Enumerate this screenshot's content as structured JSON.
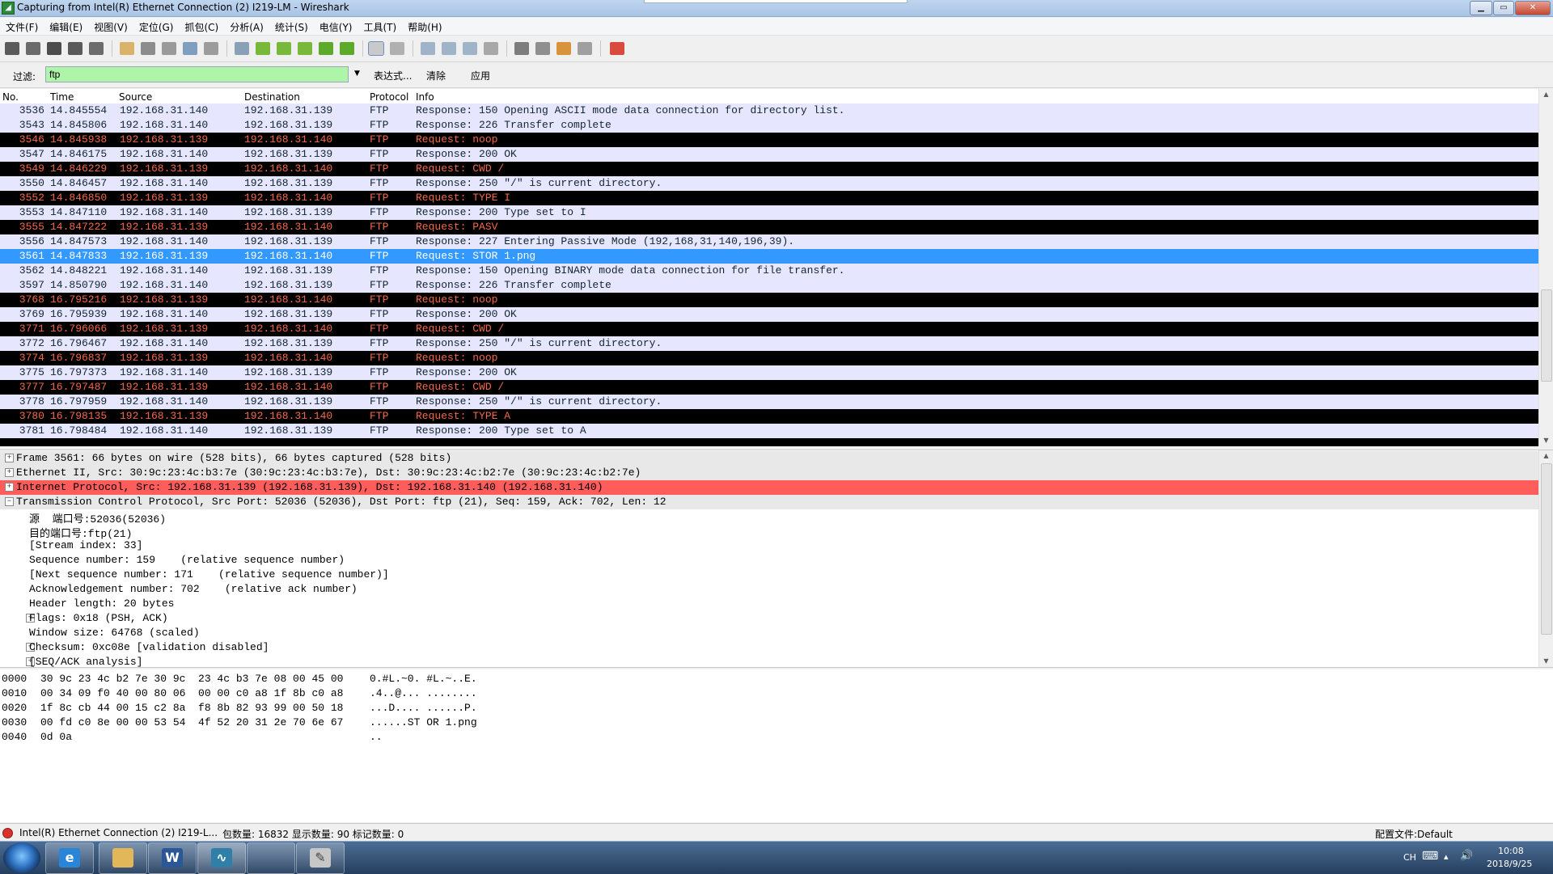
{
  "window": {
    "title": "Capturing from Intel(R) Ethernet Connection (2) I219-LM - Wireshark",
    "app_icon": "wireshark-icon",
    "controls": [
      "minimize-icon",
      "maximize-icon",
      "close-icon"
    ]
  },
  "menu": [
    "文件(F)",
    "编辑(E)",
    "视图(V)",
    "定位(G)",
    "抓包(C)",
    "分析(A)",
    "统计(S)",
    "电信(Y)",
    "工具(T)",
    "帮助(H)"
  ],
  "toolbar": {
    "icons": [
      "interfaces-icon",
      "options-icon",
      "start-capture-icon",
      "stop-capture-icon",
      "restart-capture-icon",
      "open-file-icon",
      "save-file-icon",
      "close-file-icon",
      "reload-icon",
      "print-icon",
      "find-packet-icon",
      "go-back-icon",
      "go-forward-icon",
      "go-to-packet-icon",
      "go-first-icon",
      "go-last-icon",
      "colorize-icon",
      "autoscroll-icon",
      "zoom-in-icon",
      "zoom-out-icon",
      "normal-size-icon",
      "resize-columns-icon",
      "capture-filters-icon",
      "display-filters-icon",
      "coloring-rules-icon",
      "preferences-icon",
      "help-icon"
    ]
  },
  "filter": {
    "label": "过滤:",
    "value": "ftp",
    "expression_label": "表达式...",
    "clear_label": "清除",
    "apply_label": "应用",
    "valid_color": "#aff5a9"
  },
  "packet_list": {
    "columns": [
      "No.",
      "Time",
      "Source",
      "Destination",
      "Protocol",
      "Info"
    ],
    "rows": [
      {
        "no": "3536",
        "time": "14.845554",
        "src": "192.168.31.140",
        "dst": "192.168.31.139",
        "proto": "FTP",
        "info": "Response: 150 Opening ASCII mode data connection for directory list.",
        "style": "resp"
      },
      {
        "no": "3543",
        "time": "14.845806",
        "src": "192.168.31.140",
        "dst": "192.168.31.139",
        "proto": "FTP",
        "info": "Response: 226 Transfer complete",
        "style": "resp"
      },
      {
        "no": "3546",
        "time": "14.845938",
        "src": "192.168.31.139",
        "dst": "192.168.31.140",
        "proto": "FTP",
        "info": "Request: noop",
        "style": "req"
      },
      {
        "no": "3547",
        "time": "14.846175",
        "src": "192.168.31.140",
        "dst": "192.168.31.139",
        "proto": "FTP",
        "info": "Response: 200 OK",
        "style": "resp"
      },
      {
        "no": "3549",
        "time": "14.846229",
        "src": "192.168.31.139",
        "dst": "192.168.31.140",
        "proto": "FTP",
        "info": "Request: CWD /",
        "style": "req"
      },
      {
        "no": "3550",
        "time": "14.846457",
        "src": "192.168.31.140",
        "dst": "192.168.31.139",
        "proto": "FTP",
        "info": "Response: 250 \"/\" is current directory.",
        "style": "resp"
      },
      {
        "no": "3552",
        "time": "14.846850",
        "src": "192.168.31.139",
        "dst": "192.168.31.140",
        "proto": "FTP",
        "info": "Request: TYPE I",
        "style": "req"
      },
      {
        "no": "3553",
        "time": "14.847110",
        "src": "192.168.31.140",
        "dst": "192.168.31.139",
        "proto": "FTP",
        "info": "Response: 200 Type set to I",
        "style": "resp"
      },
      {
        "no": "3555",
        "time": "14.847222",
        "src": "192.168.31.139",
        "dst": "192.168.31.140",
        "proto": "FTP",
        "info": "Request: PASV",
        "style": "req"
      },
      {
        "no": "3556",
        "time": "14.847573",
        "src": "192.168.31.140",
        "dst": "192.168.31.139",
        "proto": "FTP",
        "info": "Response: 227 Entering Passive Mode (192,168,31,140,196,39).",
        "style": "resp"
      },
      {
        "no": "3561",
        "time": "14.847833",
        "src": "192.168.31.139",
        "dst": "192.168.31.140",
        "proto": "FTP",
        "info": "Request: STOR 1.png",
        "style": "sel"
      },
      {
        "no": "3562",
        "time": "14.848221",
        "src": "192.168.31.140",
        "dst": "192.168.31.139",
        "proto": "FTP",
        "info": "Response: 150 Opening BINARY mode data connection for file transfer.",
        "style": "resp"
      },
      {
        "no": "3597",
        "time": "14.850790",
        "src": "192.168.31.140",
        "dst": "192.168.31.139",
        "proto": "FTP",
        "info": "Response: 226 Transfer complete",
        "style": "resp"
      },
      {
        "no": "3768",
        "time": "16.795216",
        "src": "192.168.31.139",
        "dst": "192.168.31.140",
        "proto": "FTP",
        "info": "Request: noop",
        "style": "req"
      },
      {
        "no": "3769",
        "time": "16.795939",
        "src": "192.168.31.140",
        "dst": "192.168.31.139",
        "proto": "FTP",
        "info": "Response: 200 OK",
        "style": "resp"
      },
      {
        "no": "3771",
        "time": "16.796066",
        "src": "192.168.31.139",
        "dst": "192.168.31.140",
        "proto": "FTP",
        "info": "Request: CWD /",
        "style": "req"
      },
      {
        "no": "3772",
        "time": "16.796467",
        "src": "192.168.31.140",
        "dst": "192.168.31.139",
        "proto": "FTP",
        "info": "Response: 250 \"/\" is current directory.",
        "style": "resp"
      },
      {
        "no": "3774",
        "time": "16.796837",
        "src": "192.168.31.139",
        "dst": "192.168.31.140",
        "proto": "FTP",
        "info": "Request: noop",
        "style": "req"
      },
      {
        "no": "3775",
        "time": "16.797373",
        "src": "192.168.31.140",
        "dst": "192.168.31.139",
        "proto": "FTP",
        "info": "Response: 200 OK",
        "style": "resp"
      },
      {
        "no": "3777",
        "time": "16.797487",
        "src": "192.168.31.139",
        "dst": "192.168.31.140",
        "proto": "FTP",
        "info": "Request: CWD /",
        "style": "req"
      },
      {
        "no": "3778",
        "time": "16.797959",
        "src": "192.168.31.140",
        "dst": "192.168.31.139",
        "proto": "FTP",
        "info": "Response: 250 \"/\" is current directory.",
        "style": "resp"
      },
      {
        "no": "3780",
        "time": "16.798135",
        "src": "192.168.31.139",
        "dst": "192.168.31.140",
        "proto": "FTP",
        "info": "Request: TYPE A",
        "style": "req"
      },
      {
        "no": "3781",
        "time": "16.798484",
        "src": "192.168.31.140",
        "dst": "192.168.31.139",
        "proto": "FTP",
        "info": "Response: 200 Type set to A",
        "style": "resp"
      }
    ]
  },
  "details": [
    {
      "text": "Frame 3561: 66 bytes on wire (528 bits), 66 bytes captured (528 bits)",
      "expander": "+",
      "style": "gray",
      "indent": 0
    },
    {
      "text": "Ethernet II, Src: 30:9c:23:4c:b3:7e (30:9c:23:4c:b3:7e), Dst: 30:9c:23:4c:b2:7e (30:9c:23:4c:b2:7e)",
      "expander": "+",
      "style": "gray",
      "indent": 0
    },
    {
      "text": "Internet Protocol, Src: 192.168.31.139 (192.168.31.139), Dst: 192.168.31.140 (192.168.31.140)",
      "expander": "+",
      "style": "red",
      "indent": 0
    },
    {
      "text": "Transmission Control Protocol, Src Port: 52036 (52036), Dst Port: ftp (21), Seq: 159, Ack: 702, Len: 12",
      "expander": "−",
      "style": "gray",
      "indent": 0
    },
    {
      "text": "源  端口号:52036(52036)",
      "expander": "",
      "style": "",
      "indent": 1
    },
    {
      "text": "目的端口号:ftp(21)",
      "expander": "",
      "style": "",
      "indent": 1
    },
    {
      "text": "[Stream index: 33]",
      "expander": "",
      "style": "",
      "indent": 1
    },
    {
      "text": "Sequence number: 159    (relative sequence number)",
      "expander": "",
      "style": "",
      "indent": 1
    },
    {
      "text": "[Next sequence number: 171    (relative sequence number)]",
      "expander": "",
      "style": "",
      "indent": 1
    },
    {
      "text": "Acknowledgement number: 702    (relative ack number)",
      "expander": "",
      "style": "",
      "indent": 1
    },
    {
      "text": "Header length: 20 bytes",
      "expander": "",
      "style": "",
      "indent": 1
    },
    {
      "text": "Flags: 0x18 (PSH, ACK)",
      "expander": "+",
      "style": "",
      "indent": 1
    },
    {
      "text": "Window size: 64768 (scaled)",
      "expander": "",
      "style": "",
      "indent": 1
    },
    {
      "text": "Checksum: 0xc08e [validation disabled]",
      "expander": "+",
      "style": "",
      "indent": 1
    },
    {
      "text": "[SEQ/ACK analysis]",
      "expander": "+",
      "style": "",
      "indent": 1
    }
  ],
  "bytes": [
    {
      "offset": "0000",
      "hex": "30 9c 23 4c b2 7e 30 9c  23 4c b3 7e 08 00 45 00",
      "ascii": "0.#L.~0. #L.~..E."
    },
    {
      "offset": "0010",
      "hex": "00 34 09 f0 40 00 80 06  00 00 c0 a8 1f 8b c0 a8",
      "ascii": ".4..@... ........"
    },
    {
      "offset": "0020",
      "hex": "1f 8c cb 44 00 15 c2 8a  f8 8b 82 93 99 00 50 18",
      "ascii": "...D.... ......P."
    },
    {
      "offset": "0030",
      "hex": "00 fd c0 8e 00 00 53 54  4f 52 20 31 2e 70 6e 67",
      "ascii": "......ST OR 1.png"
    },
    {
      "offset": "0040",
      "hex": "0d 0a",
      "ascii": ".."
    }
  ],
  "status": {
    "interface": "Intel(R) Ethernet Connection (2) I219-L...",
    "counts": "包数量: 16832 显示数量: 90 标记数量: 0",
    "profile": "配置文件:Default"
  },
  "taskbar": {
    "apps": [
      "internet-explorer-icon",
      "file-explorer-icon",
      "word-icon",
      "wireshark-icon",
      "blank-window-icon",
      "paint-icon"
    ],
    "lang": "CH",
    "time": "10:08",
    "date": "2018/9/25"
  },
  "colors": {
    "response_bg": "#e7e6ff",
    "request_bg": "#000000",
    "request_fg": "#f3684a",
    "selected_bg": "#3399ff",
    "ip_highlight": "#ff5c5c"
  }
}
